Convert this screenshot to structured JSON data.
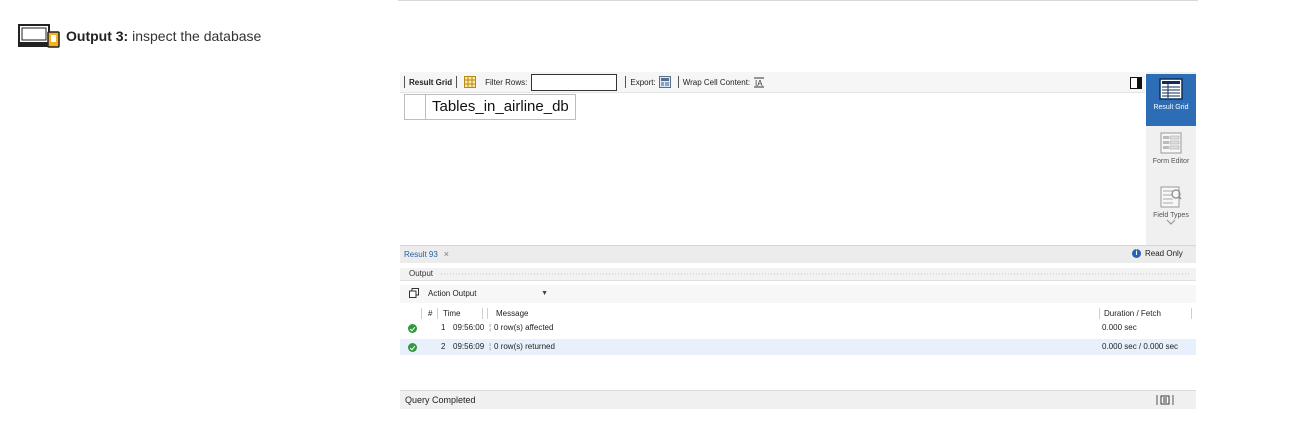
{
  "header": {
    "output_label": "Output 3:",
    "output_desc": "inspect the database",
    "icon": "laptop-output-icon"
  },
  "toolbar": {
    "result_grid": "Result Grid",
    "filter_rows": "Filter Rows:",
    "filter_value": "",
    "export": "Export:",
    "wrap": "Wrap Cell Content:"
  },
  "grid": {
    "columns": [
      "Tables_in_airline_db"
    ],
    "rows": []
  },
  "side_panel": {
    "buttons": [
      {
        "label": "Result Grid",
        "icon": "result-grid-icon",
        "active": true
      },
      {
        "label": "Form Editor",
        "icon": "form-editor-icon",
        "active": false
      },
      {
        "label": "Field Types",
        "icon": "field-types-icon",
        "active": false
      }
    ]
  },
  "result_tab": {
    "label": "Result 93",
    "close": "×",
    "read_only": "Read Only"
  },
  "output": {
    "title": "Output",
    "action_select": "Action Output",
    "columns": {
      "num": "#",
      "time": "Time",
      "message": "Message",
      "duration": "Duration / Fetch"
    },
    "rows": [
      {
        "num": "1",
        "time": "09:56:00",
        "action": "",
        "message": "0 row(s) affected",
        "duration": "0.000 sec"
      },
      {
        "num": "2",
        "time": "09:56:09",
        "action": "",
        "message": "0 row(s) returned",
        "duration": "0.000 sec / 0.000 sec"
      }
    ]
  },
  "status": {
    "text": "Query Completed"
  },
  "colors": {
    "accent": "#2d6db5",
    "success": "#2e9a3a",
    "selected_row": "#e8f1fb"
  }
}
